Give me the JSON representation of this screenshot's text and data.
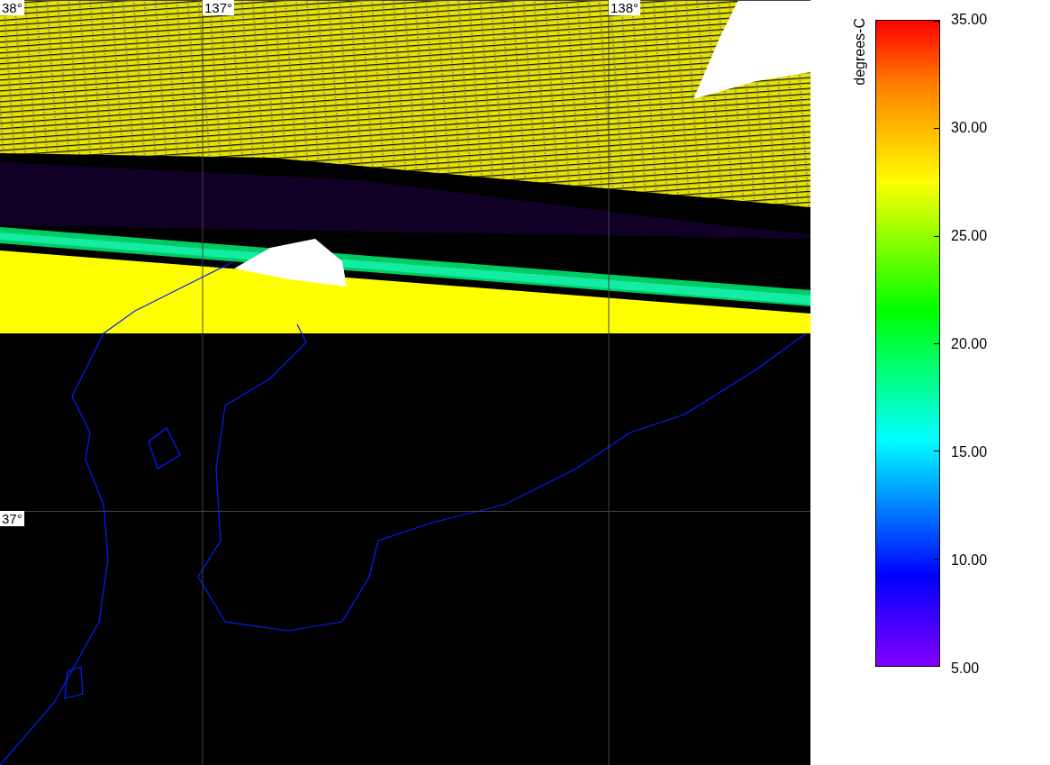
{
  "map": {
    "latitude_labels": [
      "38°",
      "37°"
    ],
    "longitude_labels": [
      "137°",
      "138°"
    ]
  },
  "colorbar": {
    "title": "degrees-C",
    "ticks": [
      "35.00",
      "30.00",
      "25.00",
      "20.00",
      "15.00",
      "10.00",
      "5.00"
    ]
  }
}
